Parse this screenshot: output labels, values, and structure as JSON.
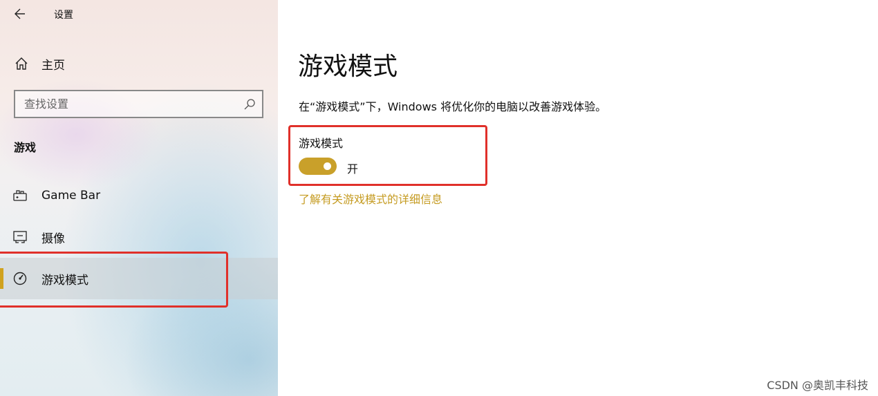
{
  "window": {
    "title": "设置"
  },
  "sidebar": {
    "home_label": "主页",
    "search_placeholder": "查找设置",
    "section_label": "游戏",
    "items": [
      {
        "label": "Game Bar",
        "icon": "gamebar-icon"
      },
      {
        "label": "摄像",
        "icon": "capture-icon"
      },
      {
        "label": "游戏模式",
        "icon": "gamemode-icon",
        "selected": true
      }
    ]
  },
  "main": {
    "title": "游戏模式",
    "description": "在“游戏模式”下，Windows 将优化你的电脑以改善游戏体验。",
    "setting_label": "游戏模式",
    "toggle_state": "开",
    "toggle_on": true,
    "learn_more": "了解有关游戏模式的详细信息"
  },
  "watermark": "CSDN @奥凯丰科技",
  "colors": {
    "accent": "#c9a02a",
    "highlight_box": "#e0302a",
    "link": "#c59b21"
  }
}
